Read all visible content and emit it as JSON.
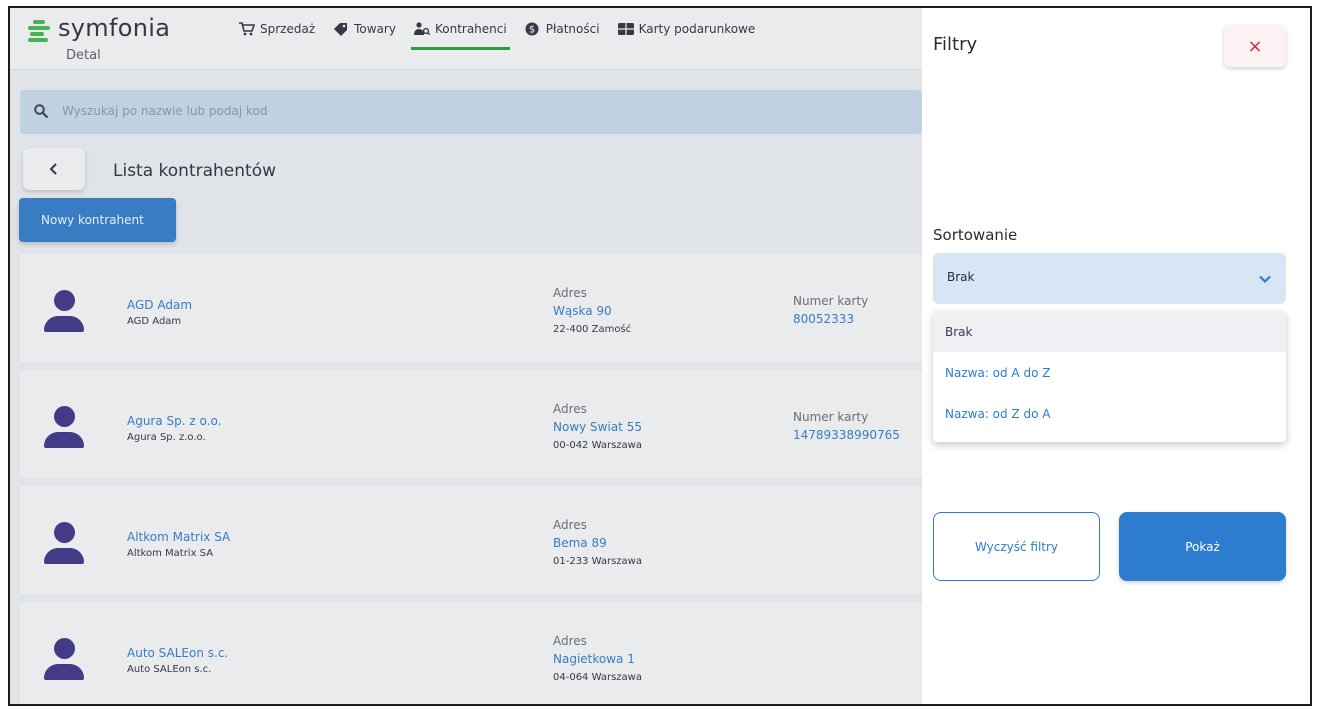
{
  "app": {
    "logo_text": "symfonia",
    "logo_sub": "Detal"
  },
  "nav": [
    {
      "label": "Sprzedaż",
      "icon": "cart-icon"
    },
    {
      "label": "Towary",
      "icon": "tag-icon"
    },
    {
      "label": "Kontrahenci",
      "icon": "contacts-icon",
      "active": true
    },
    {
      "label": "Płatności",
      "icon": "dollar-icon"
    },
    {
      "label": "Karty podarunkowe",
      "icon": "gift-card-icon"
    }
  ],
  "search": {
    "placeholder": "Wyszukaj po nazwie lub podaj kod"
  },
  "page": {
    "title": "Lista kontrahentów",
    "new_button": "Nowy kontrahent"
  },
  "contractors": [
    {
      "name": "AGD Adam",
      "sub": "AGD Adam",
      "address_label": "Adres",
      "street": "Wąska 90",
      "city": "22-400 Zamość",
      "card_label": "Numer karty",
      "card": "80052333"
    },
    {
      "name": "Agura Sp. z o.o.",
      "sub": "Agura Sp. z.o.o.",
      "address_label": "Adres",
      "street": "Nowy Swiat 55",
      "city": "00-042 Warszawa",
      "card_label": "Numer karty",
      "card": "14789338990765"
    },
    {
      "name": "Altkom Matrix SA",
      "sub": "Altkom Matrix SA",
      "address_label": "Adres",
      "street": "Bema 89",
      "city": "01-233 Warszawa",
      "card_label": "",
      "card": ""
    },
    {
      "name": "Auto SALEon s.c.",
      "sub": "Auto SALEon s.c.",
      "address_label": "Adres",
      "street": "Nagietkowa 1",
      "city": "04-064 Warszawa",
      "card_label": "",
      "card": ""
    }
  ],
  "filters": {
    "title": "Filtry",
    "close": "×",
    "sort_label": "Sortowanie",
    "sort_value": "Brak",
    "options": [
      "Brak",
      "Nazwa: od A do Z",
      "Nazwa: od Z do A"
    ],
    "clear_button": "Wyczyść filtry",
    "show_button": "Pokaż"
  },
  "colors": {
    "accent": "#2d7ccf",
    "brand_green": "#3dbb48",
    "danger": "#d6283a",
    "avatar": "#3b2e86"
  }
}
